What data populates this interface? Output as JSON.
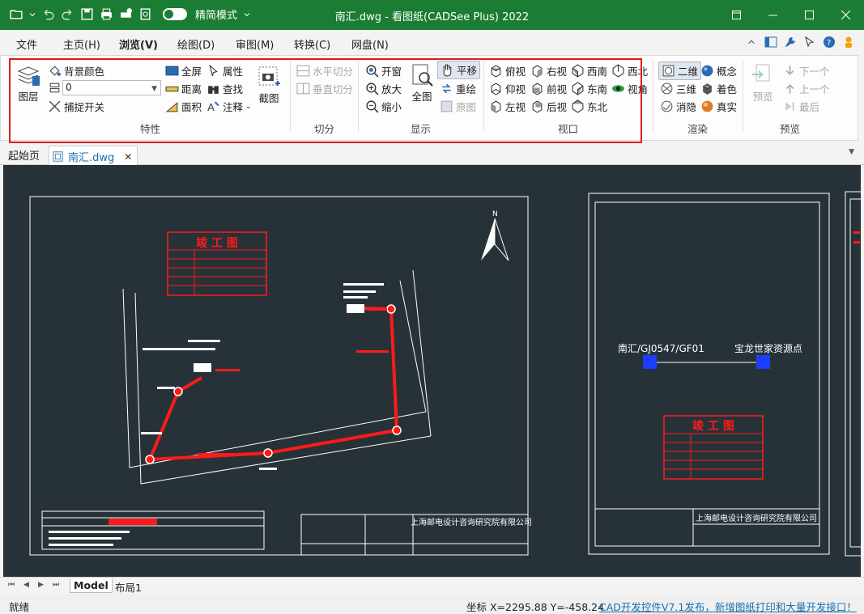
{
  "window": {
    "title": "南汇.dwg - 看图纸(CADSee Plus) 2022",
    "mode_label": "精简模式"
  },
  "menu": {
    "items": [
      "文件",
      "主页(H)",
      "浏览(V)",
      "绘图(D)",
      "审图(M)",
      "转换(C)",
      "网盘(N)"
    ],
    "active": "浏览(V)"
  },
  "ribbon": {
    "props": {
      "layers": "图层",
      "bgcolor": "背景颜色",
      "layer_value": "0",
      "snap": "捕捉开关",
      "fullscreen": "全屏",
      "distance": "距离",
      "area": "面积",
      "attribute": "属性",
      "find": "查找",
      "annotate": "注释",
      "screenshot": "截图",
      "group": "特性"
    },
    "split": {
      "horizontal": "水平切分",
      "vertical": "垂直切分",
      "group": "切分"
    },
    "display": {
      "open_window": "开窗",
      "zoom_in": "放大",
      "zoom_out": "缩小",
      "whole": "全图",
      "pan": "平移",
      "redraw": "重绘",
      "original": "原图",
      "group": "显示"
    },
    "viewport": {
      "top": "俯视",
      "bottom": "仰视",
      "left": "左视",
      "right": "右视",
      "front": "前视",
      "back": "后视",
      "sw": "西南",
      "se": "东南",
      "ne": "东北",
      "nw": "西北",
      "angle": "视角",
      "group": "视口"
    },
    "render": {
      "two_d": "二维",
      "three_d": "三维",
      "hidden": "消隐",
      "concept": "概念",
      "shade": "着色",
      "realistic": "真实",
      "group": "渲染"
    },
    "preview": {
      "preview": "预览",
      "next": "下一个",
      "prev": "上一个",
      "last": "最后",
      "group": "预览"
    }
  },
  "doc_tabs": {
    "home": "起始页",
    "file": "南汇.dwg"
  },
  "layout_tabs": [
    "Model",
    "布局1"
  ],
  "drawing": {
    "title_box": "竣 工 图",
    "company": "上海邮电设计咨询研究院有限公司",
    "right_title": "南汇/GJ0547/GF01",
    "right_dest": "宝龙世家资源点",
    "north": "N"
  },
  "status": {
    "ready": "就绪",
    "coords": "坐标 X=2295.88 Y=-458.24",
    "link": "CAD开发控件V7.1发布，新增图纸打印和大量开发接口！"
  },
  "colors": {
    "brand": "#1a7d33",
    "canvas": "#263238",
    "highlight": "#e21b1b"
  }
}
